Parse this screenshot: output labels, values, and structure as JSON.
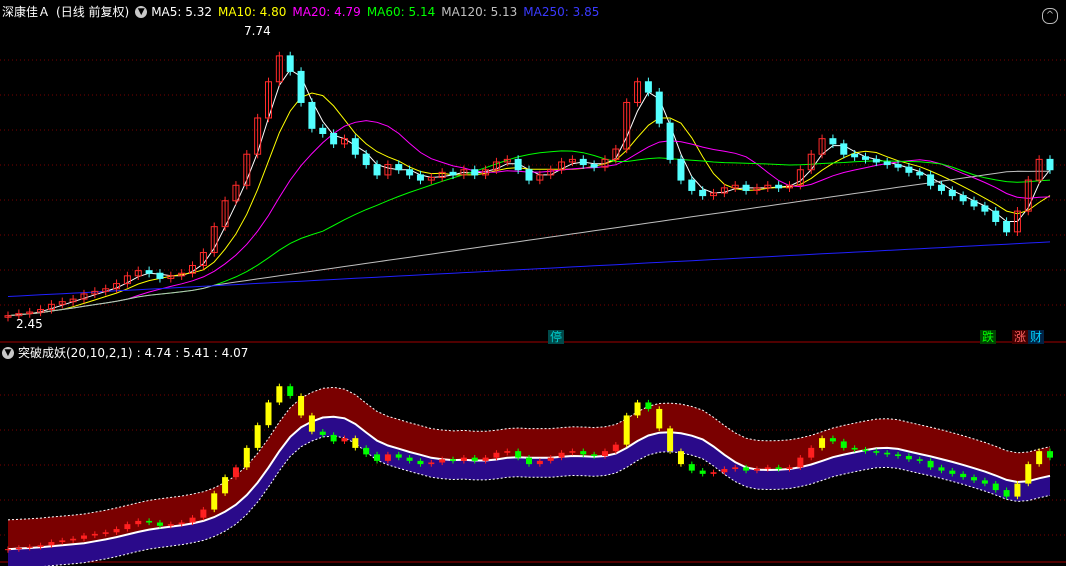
{
  "header": {
    "stock_name": "深康佳Ａ",
    "period": "(日线 前复权)",
    "ma": [
      {
        "label": "MA5: 5.32",
        "color": "#ffffff"
      },
      {
        "label": "MA10: 4.80",
        "color": "#ffff00"
      },
      {
        "label": "MA20: 4.79",
        "color": "#ff00ff"
      },
      {
        "label": "MA60: 5.14",
        "color": "#00ff00"
      },
      {
        "label": "MA120: 5.13",
        "color": "#c0c0c0"
      },
      {
        "label": "MA250: 3.85",
        "color": "#0000ff"
      }
    ]
  },
  "main_chart": {
    "high_label": "7.74",
    "low_label": "2.45",
    "tags": [
      {
        "text": "停",
        "color": "#00d0d0",
        "bg": "#004040"
      },
      {
        "text": "跌",
        "color": "#00ff00",
        "bg": "#004000"
      },
      {
        "text": "涨",
        "color": "#ff6060",
        "bg": "#400000"
      },
      {
        "text": "财",
        "color": "#00d0ff",
        "bg": "#002040"
      }
    ]
  },
  "indicator": {
    "name": "突破成妖(20,10,2,1)",
    "values": [
      ": 4.74",
      ": 5.41",
      ": 4.07"
    ]
  },
  "bottom": {
    "items": []
  },
  "colors": {
    "up": "#ff2b2b",
    "down": "#54ffff",
    "grid": "#7a0000",
    "band_upper": "#7a0000",
    "band_lower": "#2a0a8a"
  },
  "chart_data": {
    "type": "candlestick",
    "title": "深康佳Ａ",
    "ylim": [
      2.3,
      8.0
    ],
    "series": [
      {
        "name": "MA5",
        "value": 5.32
      },
      {
        "name": "MA10",
        "value": 4.8
      },
      {
        "name": "MA20",
        "value": 4.79
      },
      {
        "name": "MA60",
        "value": 5.14
      },
      {
        "name": "MA120",
        "value": 5.13
      },
      {
        "name": "MA250",
        "value": 3.85
      }
    ],
    "close": [
      2.48,
      2.52,
      2.55,
      2.6,
      2.7,
      2.75,
      2.8,
      2.9,
      2.95,
      3.0,
      3.1,
      3.25,
      3.35,
      3.3,
      3.2,
      3.25,
      3.3,
      3.45,
      3.7,
      4.2,
      4.7,
      5.0,
      5.6,
      6.3,
      7.0,
      7.5,
      7.2,
      6.6,
      6.1,
      6.0,
      5.8,
      5.9,
      5.6,
      5.4,
      5.2,
      5.4,
      5.3,
      5.2,
      5.1,
      5.15,
      5.25,
      5.2,
      5.3,
      5.2,
      5.3,
      5.45,
      5.5,
      5.3,
      5.1,
      5.2,
      5.3,
      5.45,
      5.5,
      5.4,
      5.35,
      5.5,
      5.7,
      6.6,
      7.0,
      6.8,
      6.2,
      5.5,
      5.1,
      4.9,
      4.8,
      4.85,
      4.95,
      5.0,
      4.9,
      4.95,
      5.0,
      4.95,
      5.0,
      5.3,
      5.6,
      5.9,
      5.8,
      5.6,
      5.55,
      5.5,
      5.45,
      5.4,
      5.35,
      5.25,
      5.2,
      5.0,
      4.9,
      4.8,
      4.7,
      4.6,
      4.5,
      4.3,
      4.1,
      4.5,
      5.1,
      5.5,
      5.3
    ]
  }
}
